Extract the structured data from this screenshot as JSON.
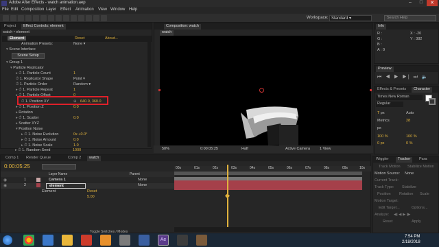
{
  "window": {
    "title": "Adobe After Effects - watch animation.aep"
  },
  "menu": [
    "File",
    "Edit",
    "Composition",
    "Layer",
    "Effect",
    "Animation",
    "View",
    "Window",
    "Help"
  ],
  "workspace": {
    "label": "Workspace:",
    "value": "Standard",
    "search_placeholder": "Search Help"
  },
  "left_tabs": {
    "project": "Project",
    "effect_controls": "Effect Controls: element"
  },
  "effect_controls": {
    "breadcrumb": "watch • element",
    "layer_chip": "Element",
    "reset": "Reset",
    "about": "About...",
    "presets_label": "Animation Presets:",
    "presets_value": "None",
    "scene_interface": "Scene Interface",
    "scene_setup": "Scene Setup",
    "group": "Group 1",
    "particle_replicator": "Particle Replicator",
    "rows": [
      {
        "label": "1. Particle Count",
        "value": "1"
      },
      {
        "label": "1. Replicator Shape",
        "value": "Point"
      },
      {
        "label": "1. Particle Order",
        "value": "Random"
      },
      {
        "label": "1. Particle Repeat",
        "value": "1"
      },
      {
        "label": "1. Particle Offset",
        "value": "0"
      },
      {
        "label": "1. Position XY",
        "value": "640.0, 360.0"
      },
      {
        "label": "1. Position Z",
        "value": "0.0"
      },
      {
        "label": "Rotation",
        "value": ""
      },
      {
        "label": "1. Scatter",
        "value": "0.0"
      },
      {
        "label": "Scatter XYZ",
        "value": ""
      },
      {
        "label": "Position Noise",
        "value": ""
      },
      {
        "label": "1. Noise Evolution",
        "value": "0x +0.0°"
      },
      {
        "label": "1. Noise Amount",
        "value": "0.0"
      },
      {
        "label": "1. Noise Scale",
        "value": "1.0"
      },
      {
        "label": "1. Random Seed",
        "value": "1000"
      }
    ]
  },
  "composition": {
    "tab": "Composition: watch",
    "sub_tab": "watch",
    "zoom": "50%",
    "timecode": "0:00:05:25",
    "resolution": "Half",
    "camera": "Active Camera",
    "views": "1 View"
  },
  "info_panel": {
    "tab": "Info",
    "r": "R :",
    "g": "G :",
    "b": "B :",
    "a": "A : 0",
    "x": "X : -20",
    "y": "Y : 382"
  },
  "preview": {
    "tab": "Preview"
  },
  "effects_presets": {
    "tab": "Effects & Presets",
    "character_tab": "Character"
  },
  "character": {
    "font": "Times New Roman",
    "style": "Regular",
    "size": "px",
    "leading": "Auto",
    "kerning": "Metrics",
    "tracking": "28",
    "stroke": "px",
    "scale_v": "100 %",
    "scale_h": "100 %",
    "baseline": "0 px",
    "tsume": "0 %"
  },
  "timeline": {
    "tabs": [
      "Comp 1",
      "Render Queue",
      "Comp 2",
      "watch"
    ],
    "timecode": "0:00:05:25",
    "search_placeholder": "",
    "col_layer": "Layer Name",
    "col_parent": "Parent",
    "layers": [
      {
        "num": "1",
        "name": "Camera 1",
        "parent": "None"
      },
      {
        "num": "2",
        "name": "element",
        "parent": "None"
      }
    ],
    "sub_effect": "Element",
    "sub_reset": "Reset",
    "sub_value": "5.00",
    "toggle_label": "Toggle Switches / Modes",
    "ruler": [
      "00s",
      "01s",
      "02s",
      "03s",
      "04s",
      "05s",
      "06s",
      "07s",
      "08s",
      "09s",
      "10s"
    ]
  },
  "tracker": {
    "tabs": [
      "Wiggler",
      "Tracker",
      "Para"
    ],
    "track_motion": "Track Motion",
    "stabilize": "Stabilize Motion",
    "motion_source": "Motion Source:",
    "motion_source_value": "None",
    "current_track": "Current Track:",
    "track_type": "Track Type:",
    "track_type_value": "Stabilize",
    "position": "Position",
    "rotation": "Rotation",
    "scale": "Scale",
    "motion_target": "Motion Target:",
    "edit_target": "Edit Target...",
    "options": "Options...",
    "analyze": "Analyze:",
    "reset": "Reset",
    "apply": "Apply"
  },
  "taskbar": {
    "time": "7:54 PM",
    "date": "2/18/2018"
  },
  "colors": {
    "accent": "#e1b33d",
    "highlight": "#e0202a",
    "layer_bar": "#a5404a"
  }
}
